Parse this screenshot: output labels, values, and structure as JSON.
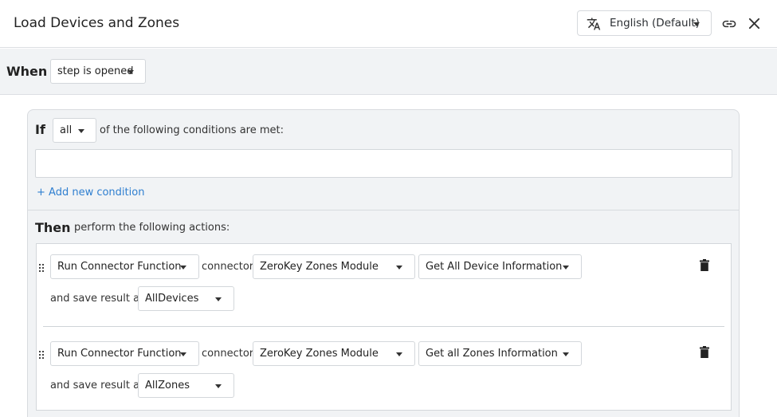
{
  "header": {
    "title": "Load Devices and Zones",
    "language_label": "English (Default)",
    "icons": {
      "language": "translate-icon",
      "link": "link-icon",
      "close": "close-icon"
    }
  },
  "when": {
    "label": "When",
    "trigger_value": "step is opened"
  },
  "if": {
    "label": "If",
    "match_value": "all",
    "text": "of the following conditions are met:",
    "condition_value": "",
    "add_condition_label": "+ Add new condition"
  },
  "then": {
    "label": "Then",
    "text": "perform the following actions:"
  },
  "actions": [
    {
      "type": "Run Connector Function",
      "connector_label": "connector:",
      "connector": "ZeroKey Zones Module",
      "function": "Get All Device Information",
      "save_label": "and save result as:",
      "result_name": "AllDevices"
    },
    {
      "type": "Run Connector Function",
      "connector_label": "connector:",
      "connector": "ZeroKey Zones Module",
      "function": "Get all Zones Information",
      "save_label": "and save result as:",
      "result_name": "AllZones"
    }
  ],
  "colors": {
    "accent_link": "#2f7fd0",
    "panel_bg": "#f1f3f5",
    "border": "#d3d7db"
  }
}
